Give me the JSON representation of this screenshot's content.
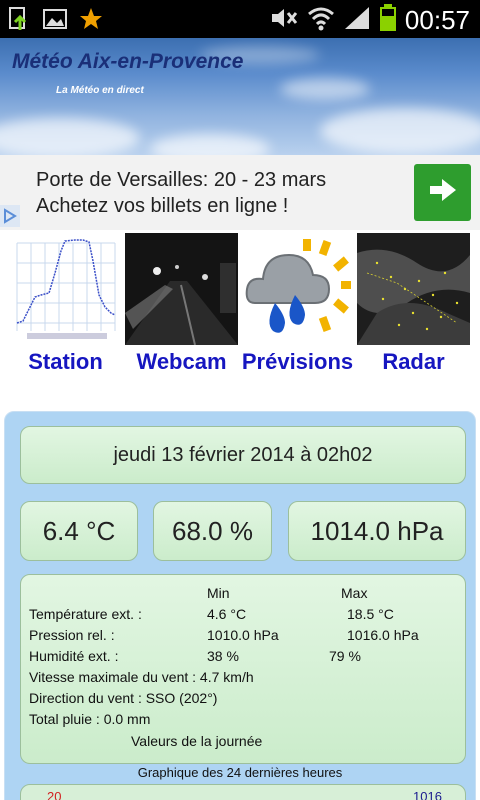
{
  "status_bar": {
    "time": "00:57",
    "icons": [
      "download-icon",
      "image-icon",
      "star-icon",
      "mute-icon",
      "wifi-icon",
      "signal-icon",
      "battery-icon"
    ]
  },
  "banner": {
    "title": "Météo Aix-en-Provence",
    "subtitle": "La Météo en direct"
  },
  "ad": {
    "line1": "Porte de Versailles: 20 - 23 mars",
    "line2": "Achetez vos billets en ligne !",
    "button_icon": "arrow-right-icon",
    "badge_icon": "adchoices-icon",
    "button_color": "#2e9d2e"
  },
  "nav": [
    {
      "label": "Station",
      "icon": "station-graph-thumbnail"
    },
    {
      "label": "Webcam",
      "icon": "webcam-thumbnail"
    },
    {
      "label": "Prévisions",
      "icon": "forecast-thumbnail"
    },
    {
      "label": "Radar",
      "icon": "radar-thumbnail"
    }
  ],
  "current": {
    "datetime": "jeudi 13 février 2014 à 02h02",
    "temperature": "6.4 °C",
    "humidity": "68.0 %",
    "pressure": "1014.0 hPa"
  },
  "summary": {
    "header_min": "Min",
    "header_max": "Max",
    "rows": [
      {
        "label": "Température ext. :",
        "min": "4.6 °C",
        "max": "18.5 °C"
      },
      {
        "label": "Pression rel. :",
        "min": "1010.0 hPa",
        "max": "1016.0 hPa"
      },
      {
        "label": "Humidité ext. :",
        "min": "38 %",
        "max": "79 %"
      }
    ],
    "wind_max": "Vitesse maximale du vent : 4.7 km/h",
    "wind_dir": "Direction du vent : SSO (202°)",
    "rain": "Total pluie : 0.0 mm",
    "footer": "Valeurs de la journée"
  },
  "graph": {
    "caption": "Graphique des 24 dernières heures",
    "left_value": "20",
    "right_value": "1016"
  },
  "colors": {
    "panel": "#aed4f3",
    "box": "#d8f1d8",
    "nav_label": "#1616c0",
    "banner_title": "#1a2f78"
  }
}
